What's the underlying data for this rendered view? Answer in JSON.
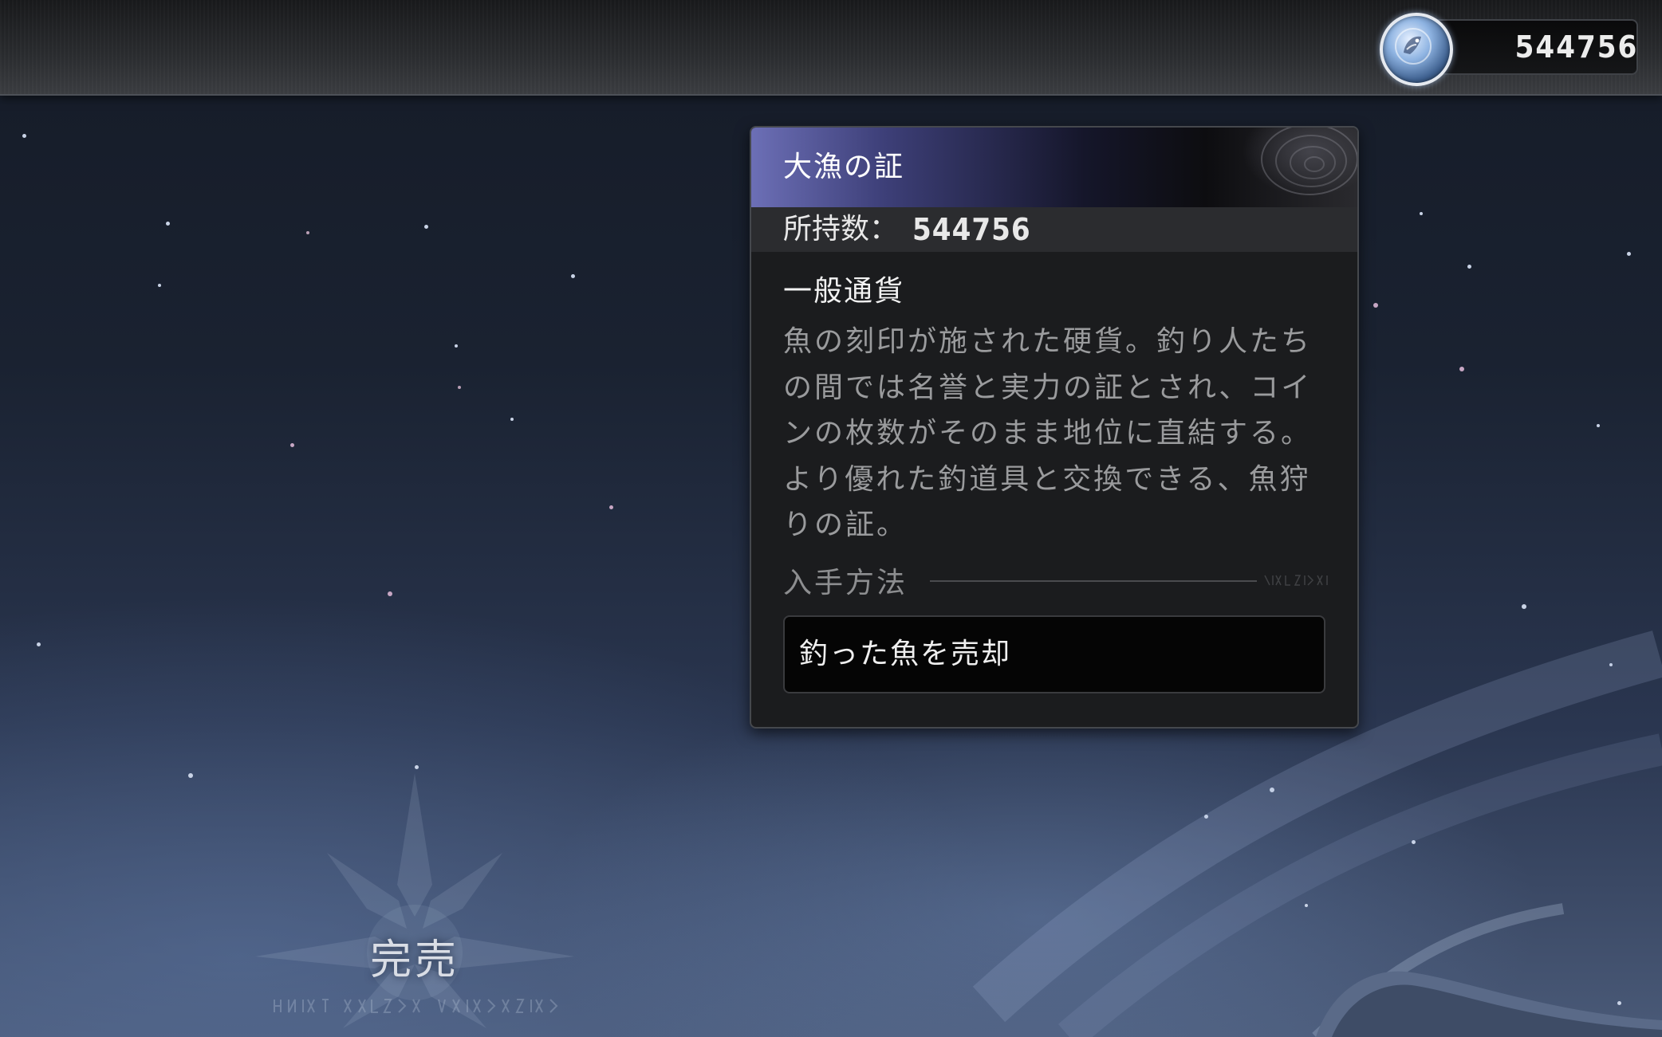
{
  "currency": {
    "icon": "fish-coin-icon",
    "amount": "544756"
  },
  "tooltip": {
    "title": "大漁の証",
    "owned_label": "所持数：",
    "owned_value": "544756",
    "category": "一般通貨",
    "description": "魚の刻印が施された硬貨。釣り人たちの間では名誉と実力の証とされ、コインの枚数がそのまま地位に直結する。より優れた釣道具と交換できる、魚狩りの証。",
    "acquisition_label": "入手方法",
    "acquisition_method": "釣った魚を売却"
  },
  "status": {
    "sold_out": "完売"
  },
  "colors": {
    "title_gradient_start": "#6c6fb6",
    "panel_bg": "#1b1c1e",
    "description_text": "#9a9b9d"
  }
}
